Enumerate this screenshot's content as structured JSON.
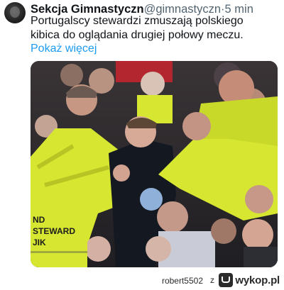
{
  "tweet": {
    "author_name": "Sekcja Gimnastyczn",
    "handle": "@gimnastyczn",
    "separator": "·",
    "time": "5 min",
    "text": "Portugalscy stewardzi zmuszają polskiego kibica do oglądania drugiej połowy meczu.",
    "show_more": "Pokaż więcej"
  },
  "photo": {
    "vest_text_1": "ND",
    "vest_text_2": "STEWARD",
    "vest_text_3": "JIK"
  },
  "footer": {
    "username": "robert5502",
    "connector": "z",
    "brand": "wykop.pl"
  },
  "colors": {
    "link": "#1d9bf0",
    "vest": "#d6e631",
    "text": "#0f1419",
    "muted": "#536471"
  }
}
